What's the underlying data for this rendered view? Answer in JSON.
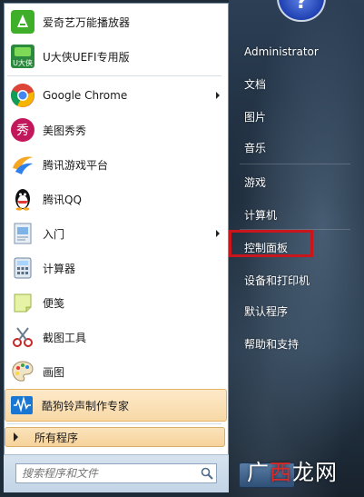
{
  "pinned": [
    {
      "label": "爱奇艺万能播放器",
      "icon": "iqiyi-player-icon"
    },
    {
      "label": "U大侠UEFI专用版",
      "icon": "udaxia-icon",
      "icon_text": "U大侠"
    }
  ],
  "recent": [
    {
      "label": "Google Chrome",
      "icon": "chrome-icon",
      "submenu": true
    },
    {
      "label": "美图秀秀",
      "icon": "meitu-icon",
      "icon_text": "秀"
    },
    {
      "label": "腾讯游戏平台",
      "icon": "tencent-game-icon"
    },
    {
      "label": "腾讯QQ",
      "icon": "qq-penguin-icon"
    },
    {
      "label": "入门",
      "icon": "getting-started-icon",
      "submenu": true
    },
    {
      "label": "计算器",
      "icon": "calculator-icon"
    },
    {
      "label": "便笺",
      "icon": "sticky-notes-icon"
    },
    {
      "label": "截图工具",
      "icon": "snipping-tool-icon"
    },
    {
      "label": "画图",
      "icon": "paint-icon"
    },
    {
      "label": "酷狗铃声制作专家",
      "icon": "kugou-ringtone-icon",
      "highlighted": true
    }
  ],
  "all_programs": "所有程序",
  "search": {
    "placeholder": "搜索程序和文件"
  },
  "right": {
    "user": "Administrator",
    "items": [
      "文档",
      "图片",
      "音乐",
      "游戏",
      "计算机",
      "控制面板",
      "设备和打印机",
      "默认程序",
      "帮助和支持"
    ],
    "highlighted_item": "控制面板"
  },
  "user_pic_text": "?",
  "watermark": {
    "part1": "广",
    "part2": "西",
    "part3": "龙网"
  },
  "colors": {
    "highlight": "#f8d9a6",
    "red_box": "#c8161c",
    "chrome_red": "#db4437"
  }
}
